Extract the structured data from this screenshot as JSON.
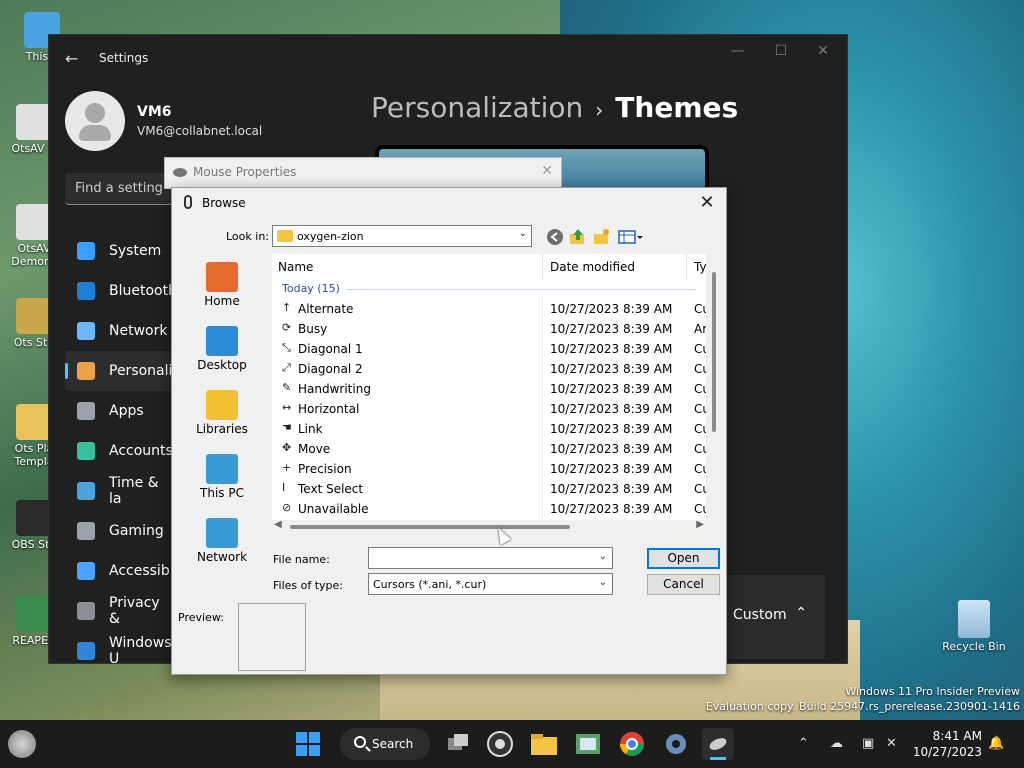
{
  "desktop": {
    "icons": [
      {
        "label": "This P",
        "color": "#4aa3df"
      },
      {
        "label": "OtsAV D",
        "color": "#e0e0e0"
      },
      {
        "label": "OtsAV\nDemons",
        "color": "#e0e0e0"
      },
      {
        "label": "Ots Stu",
        "color": "#c9a74a"
      },
      {
        "label": "Ots Pla\nTempla",
        "color": "#e8c15a"
      },
      {
        "label": "OBS Stu",
        "color": "#2a2a2a"
      },
      {
        "label": "REAPER",
        "color": "#3b8b4d"
      }
    ],
    "recycle_bin": "Recycle Bin",
    "watermark_line1": "Windows 11 Pro Insider Preview",
    "watermark_line2": "Evaluation copy. Build 25947.rs_prerelease.230901-1416"
  },
  "settings": {
    "title": "Settings",
    "user_name": "VM6",
    "user_email": "VM6@collabnet.local",
    "find_placeholder": "Find a setting",
    "breadcrumb_parent": "Personalization",
    "breadcrumb_current": "Themes",
    "custom_label": "Custom",
    "nav": [
      {
        "label": "System",
        "color": "#3aa0ff",
        "icon": "monitor-icon"
      },
      {
        "label": "Bluetooth",
        "color": "#1e7fd6",
        "icon": "bluetooth-icon"
      },
      {
        "label": "Network",
        "color": "#6ab8ff",
        "icon": "wifi-icon"
      },
      {
        "label": "Personaliz",
        "color": "#e8a24a",
        "icon": "brush-icon"
      },
      {
        "label": "Apps",
        "color": "#9aa3ad",
        "icon": "apps-icon"
      },
      {
        "label": "Accounts",
        "color": "#36c0a0",
        "icon": "person-icon"
      },
      {
        "label": "Time & la",
        "color": "#4aa3df",
        "icon": "globe-icon"
      },
      {
        "label": "Gaming",
        "color": "#9aa3ad",
        "icon": "controller-icon"
      },
      {
        "label": "Accessibi",
        "color": "#4aa3ff",
        "icon": "accessibility-icon"
      },
      {
        "label": "Privacy &",
        "color": "#8a8f96",
        "icon": "shield-icon"
      },
      {
        "label": "Windows U",
        "color": "#2f86d6",
        "icon": "update-icon"
      }
    ]
  },
  "mouse_properties": {
    "title": "Mouse Properties"
  },
  "browse": {
    "title": "Browse",
    "look_in_label": "Look in:",
    "look_in_value": "oxygen-zion",
    "places": [
      {
        "label": "Home",
        "color": "#e46a2e",
        "icon": "home-icon"
      },
      {
        "label": "Desktop",
        "color": "#2e8bd6",
        "icon": "desktop-icon"
      },
      {
        "label": "Libraries",
        "color": "#f2c030",
        "icon": "libraries-icon"
      },
      {
        "label": "This PC",
        "color": "#3a9ad8",
        "icon": "computer-icon"
      },
      {
        "label": "Network",
        "color": "#3a9ad8",
        "icon": "network-icon"
      }
    ],
    "columns": {
      "name": "Name",
      "date": "Date modified",
      "type": "Ty"
    },
    "group": "Today (15)",
    "files": [
      {
        "name": "Alternate",
        "date": "10/27/2023 8:39 AM",
        "type": "Cu",
        "glyph": "↑"
      },
      {
        "name": "Busy",
        "date": "10/27/2023 8:39 AM",
        "type": "Ar",
        "glyph": "⟳"
      },
      {
        "name": "Diagonal 1",
        "date": "10/27/2023 8:39 AM",
        "type": "Cu",
        "glyph": "⤡"
      },
      {
        "name": "Diagonal 2",
        "date": "10/27/2023 8:39 AM",
        "type": "Cu",
        "glyph": "⤢"
      },
      {
        "name": "Handwriting",
        "date": "10/27/2023 8:39 AM",
        "type": "Cu",
        "glyph": "✎"
      },
      {
        "name": "Horizontal",
        "date": "10/27/2023 8:39 AM",
        "type": "Cu",
        "glyph": "↔"
      },
      {
        "name": "Link",
        "date": "10/27/2023 8:39 AM",
        "type": "Cu",
        "glyph": "☚"
      },
      {
        "name": "Move",
        "date": "10/27/2023 8:39 AM",
        "type": "Cu",
        "glyph": "✥"
      },
      {
        "name": "Precision",
        "date": "10/27/2023 8:39 AM",
        "type": "Cu",
        "glyph": "+"
      },
      {
        "name": "Text Select",
        "date": "10/27/2023 8:39 AM",
        "type": "Cu",
        "glyph": "I"
      },
      {
        "name": "Unavailable",
        "date": "10/27/2023 8:39 AM",
        "type": "Cu",
        "glyph": "⊘"
      }
    ],
    "file_name_label": "File name:",
    "file_name_value": "",
    "files_of_type_label": "Files of type:",
    "files_of_type_value": "Cursors (*.ani, *.cur)",
    "open_label": "Open",
    "cancel_label": "Cancel",
    "preview_label": "Preview:"
  },
  "taskbar": {
    "search_label": "Search",
    "time": "8:41 AM",
    "date": "10/27/2023"
  }
}
